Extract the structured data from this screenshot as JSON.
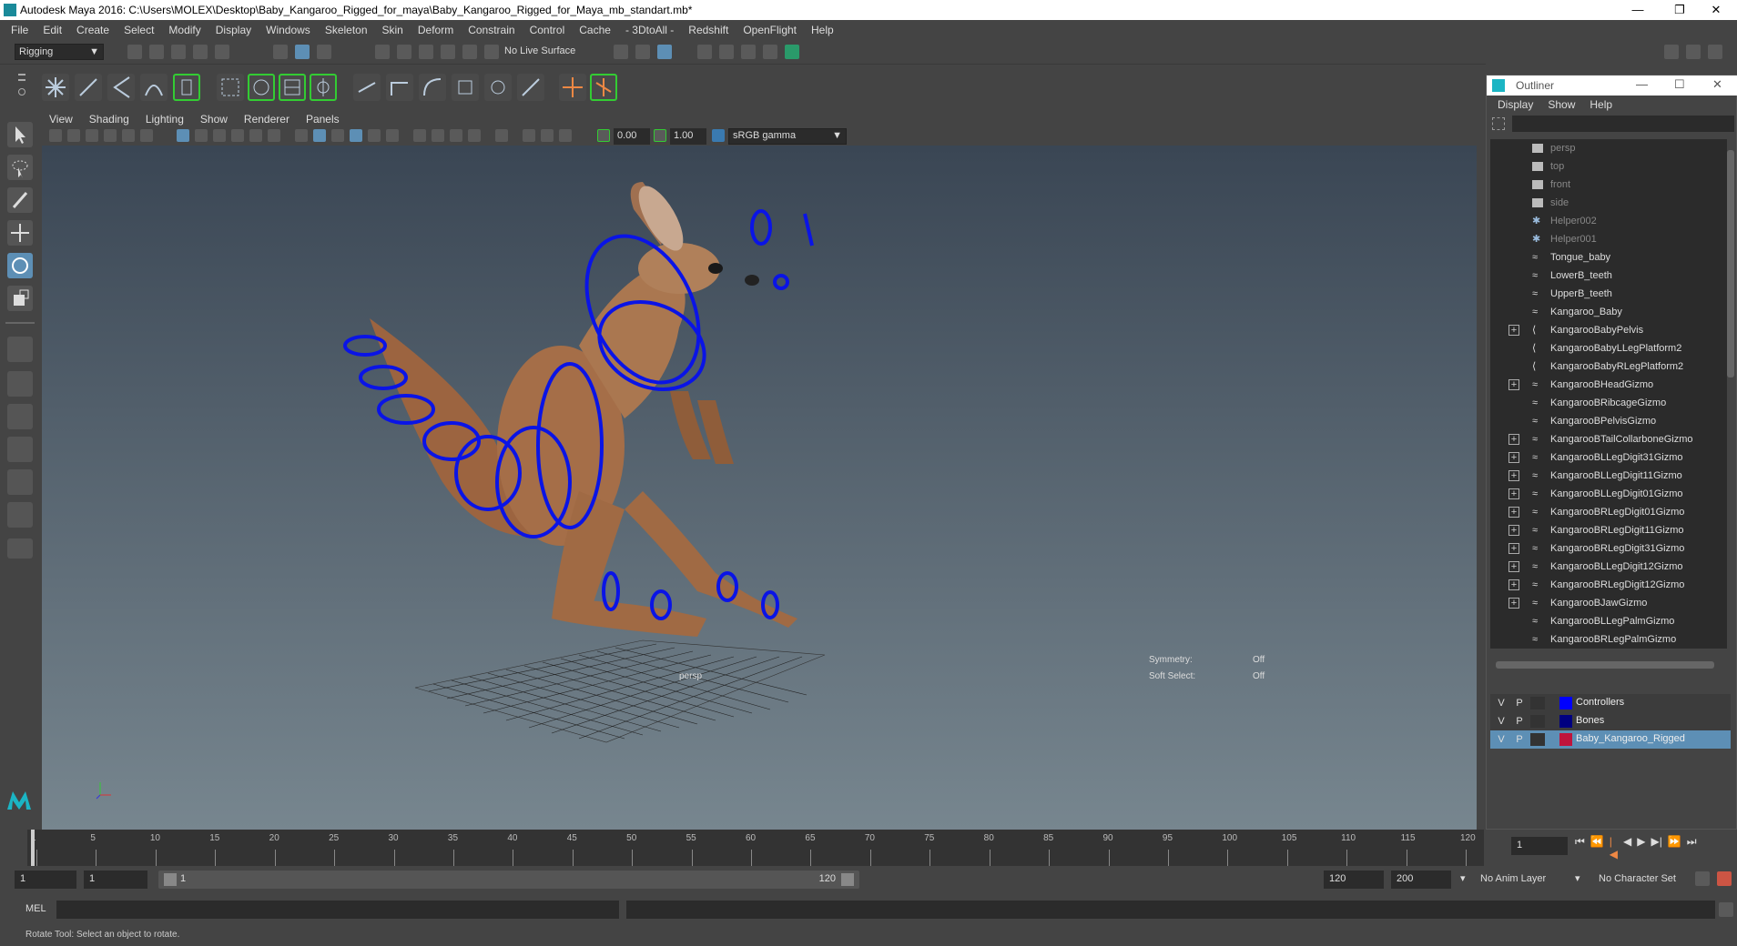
{
  "window": {
    "title": "Autodesk Maya 2016: C:\\Users\\MOLEX\\Desktop\\Baby_Kangaroo_Rigged_for_maya\\Baby_Kangaroo_Rigged_for_Maya_mb_standart.mb*",
    "minimize": "—",
    "restore": "❐",
    "close": "✕"
  },
  "menubar": [
    "File",
    "Edit",
    "Create",
    "Select",
    "Modify",
    "Display",
    "Windows",
    "Skeleton",
    "Skin",
    "Deform",
    "Constrain",
    "Control",
    "Cache",
    "- 3DtoAll -",
    "Redshift",
    "OpenFlight",
    "Help"
  ],
  "statusline": {
    "menuset": "Rigging",
    "live_surface": "No Live Surface"
  },
  "viewport": {
    "menu": [
      "View",
      "Shading",
      "Lighting",
      "Show",
      "Renderer",
      "Panels"
    ],
    "exposure": "0.00",
    "gamma": "1.00",
    "colorspace": "sRGB gamma",
    "camera_label": "persp",
    "symmetry_label": "Symmetry:",
    "symmetry_value": "Off",
    "softselect_label": "Soft Select:",
    "softselect_value": "Off"
  },
  "timeline": {
    "ticks": [
      "1",
      "5",
      "10",
      "15",
      "20",
      "25",
      "30",
      "35",
      "40",
      "45",
      "50",
      "55",
      "60",
      "65",
      "70",
      "75",
      "80",
      "85",
      "90",
      "95",
      "100",
      "105",
      "110",
      "115",
      "120"
    ],
    "current_frame": "1"
  },
  "range": {
    "start": "1",
    "playback_start": "1",
    "slider_start": "1",
    "slider_end": "120",
    "playback_end": "120",
    "end": "200",
    "anim_layer": "No Anim Layer",
    "char_set": "No Character Set"
  },
  "cmdline": {
    "mode": "MEL"
  },
  "helpline": "Rotate Tool: Select an object to rotate.",
  "outliner": {
    "title": "Outliner",
    "menu": [
      "Display",
      "Show",
      "Help"
    ],
    "items": [
      {
        "label": "persp",
        "icon": "camera-icon",
        "dim": true,
        "expand": false
      },
      {
        "label": "top",
        "icon": "camera-icon",
        "dim": true,
        "expand": false
      },
      {
        "label": "front",
        "icon": "camera-icon",
        "dim": true,
        "expand": false
      },
      {
        "label": "side",
        "icon": "camera-icon",
        "dim": true,
        "expand": false
      },
      {
        "label": "Helper002",
        "icon": "helper-icon",
        "dim": true,
        "expand": false
      },
      {
        "label": "Helper001",
        "icon": "helper-icon",
        "dim": true,
        "expand": false
      },
      {
        "label": "Tongue_baby",
        "icon": "mesh-icon",
        "dim": false,
        "expand": false
      },
      {
        "label": "LowerB_teeth",
        "icon": "mesh-icon",
        "dim": false,
        "expand": false
      },
      {
        "label": "UpperB_teeth",
        "icon": "mesh-icon",
        "dim": false,
        "expand": false
      },
      {
        "label": "Kangaroo_Baby",
        "icon": "mesh-icon",
        "dim": false,
        "expand": false
      },
      {
        "label": "KangarooBabyPelvis",
        "icon": "joint-icon",
        "dim": false,
        "expand": true
      },
      {
        "label": "KangarooBabyLLegPlatform2",
        "icon": "joint-icon",
        "dim": false,
        "expand": false
      },
      {
        "label": "KangarooBabyRLegPlatform2",
        "icon": "joint-icon",
        "dim": false,
        "expand": false
      },
      {
        "label": "KangarooBHeadGizmo",
        "icon": "curve-icon",
        "dim": false,
        "expand": true
      },
      {
        "label": "KangarooBRibcageGizmo",
        "icon": "curve-icon",
        "dim": false,
        "expand": false
      },
      {
        "label": "KangarooBPelvisGizmo",
        "icon": "curve-icon",
        "dim": false,
        "expand": false
      },
      {
        "label": "KangarooBTailCollarboneGizmo",
        "icon": "curve-icon",
        "dim": false,
        "expand": true
      },
      {
        "label": "KangarooBLLegDigit31Gizmo",
        "icon": "curve-icon",
        "dim": false,
        "expand": true
      },
      {
        "label": "KangarooBLLegDigit11Gizmo",
        "icon": "curve-icon",
        "dim": false,
        "expand": true
      },
      {
        "label": "KangarooBLLegDigit01Gizmo",
        "icon": "curve-icon",
        "dim": false,
        "expand": true
      },
      {
        "label": "KangarooBRLegDigit01Gizmo",
        "icon": "curve-icon",
        "dim": false,
        "expand": true
      },
      {
        "label": "KangarooBRLegDigit11Gizmo",
        "icon": "curve-icon",
        "dim": false,
        "expand": true
      },
      {
        "label": "KangarooBRLegDigit31Gizmo",
        "icon": "curve-icon",
        "dim": false,
        "expand": true
      },
      {
        "label": "KangarooBLLegDigit12Gizmo",
        "icon": "curve-icon",
        "dim": false,
        "expand": true
      },
      {
        "label": "KangarooBRLegDigit12Gizmo",
        "icon": "curve-icon",
        "dim": false,
        "expand": true
      },
      {
        "label": "KangarooBJawGizmo",
        "icon": "curve-icon",
        "dim": false,
        "expand": true
      },
      {
        "label": "KangarooBLLegPalmGizmo",
        "icon": "curve-icon",
        "dim": false,
        "expand": false
      },
      {
        "label": "KangarooBRLegPalmGizmo",
        "icon": "curve-icon",
        "dim": false,
        "expand": false
      }
    ],
    "layers": [
      {
        "v": "V",
        "p": "P",
        "color": "#0000ff",
        "name": "Controllers",
        "selected": false
      },
      {
        "v": "V",
        "p": "P",
        "color": "#000080",
        "name": "Bones",
        "selected": false
      },
      {
        "v": "V",
        "p": "P",
        "color": "#c0143c",
        "name": "Baby_Kangaroo_Rigged",
        "selected": true
      }
    ]
  }
}
